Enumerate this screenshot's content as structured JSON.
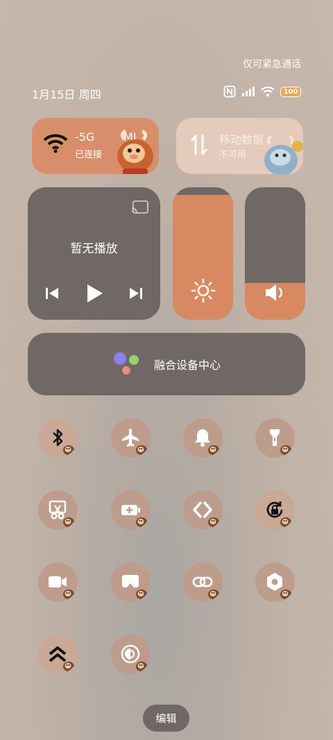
{
  "status_bar": {
    "emergency_text": "仅可紧急通话",
    "date_text": "1月15日 周四",
    "battery_level": "100",
    "icons": [
      "nfc-icon",
      "signal-icon",
      "wifi-icon",
      "battery-icon"
    ]
  },
  "wifi_tile": {
    "ssid": "-5G",
    "ssid_suffix": "MI",
    "status": "已连接"
  },
  "mobile_tile": {
    "label": "移动数据",
    "status": "不可用"
  },
  "media": {
    "now_playing": "暂无播放"
  },
  "brightness": {
    "level": 0.94
  },
  "volume": {
    "level": 0.28
  },
  "fusion": {
    "label": "融合设备中心"
  },
  "toggles": [
    {
      "name": "bluetooth",
      "icon": "bluetooth-icon"
    },
    {
      "name": "airplane",
      "icon": "airplane-icon"
    },
    {
      "name": "notification",
      "icon": "bell-icon"
    },
    {
      "name": "flashlight",
      "icon": "flashlight-icon"
    },
    {
      "name": "screenshot",
      "icon": "scissors-icon"
    },
    {
      "name": "battery-saver",
      "icon": "battery-plus-icon"
    },
    {
      "name": "nearby",
      "icon": "chevrons-icon"
    },
    {
      "name": "rotation-lock",
      "icon": "rotation-lock-icon"
    },
    {
      "name": "screen-record",
      "icon": "video-icon"
    },
    {
      "name": "cast",
      "icon": "screen-cast-icon"
    },
    {
      "name": "link",
      "icon": "link-icon"
    },
    {
      "name": "settings",
      "icon": "hex-nut-icon"
    },
    {
      "name": "performance",
      "icon": "double-chevron-up-icon"
    },
    {
      "name": "eye-comfort",
      "icon": "eye-comfort-icon"
    }
  ],
  "colors": {
    "accent": "#d98961",
    "tile_dark": "#6f6864",
    "tile_peach": "#d98e6b",
    "tile_pale": "#e4cbbb"
  },
  "edit_button": {
    "label": "编辑"
  }
}
